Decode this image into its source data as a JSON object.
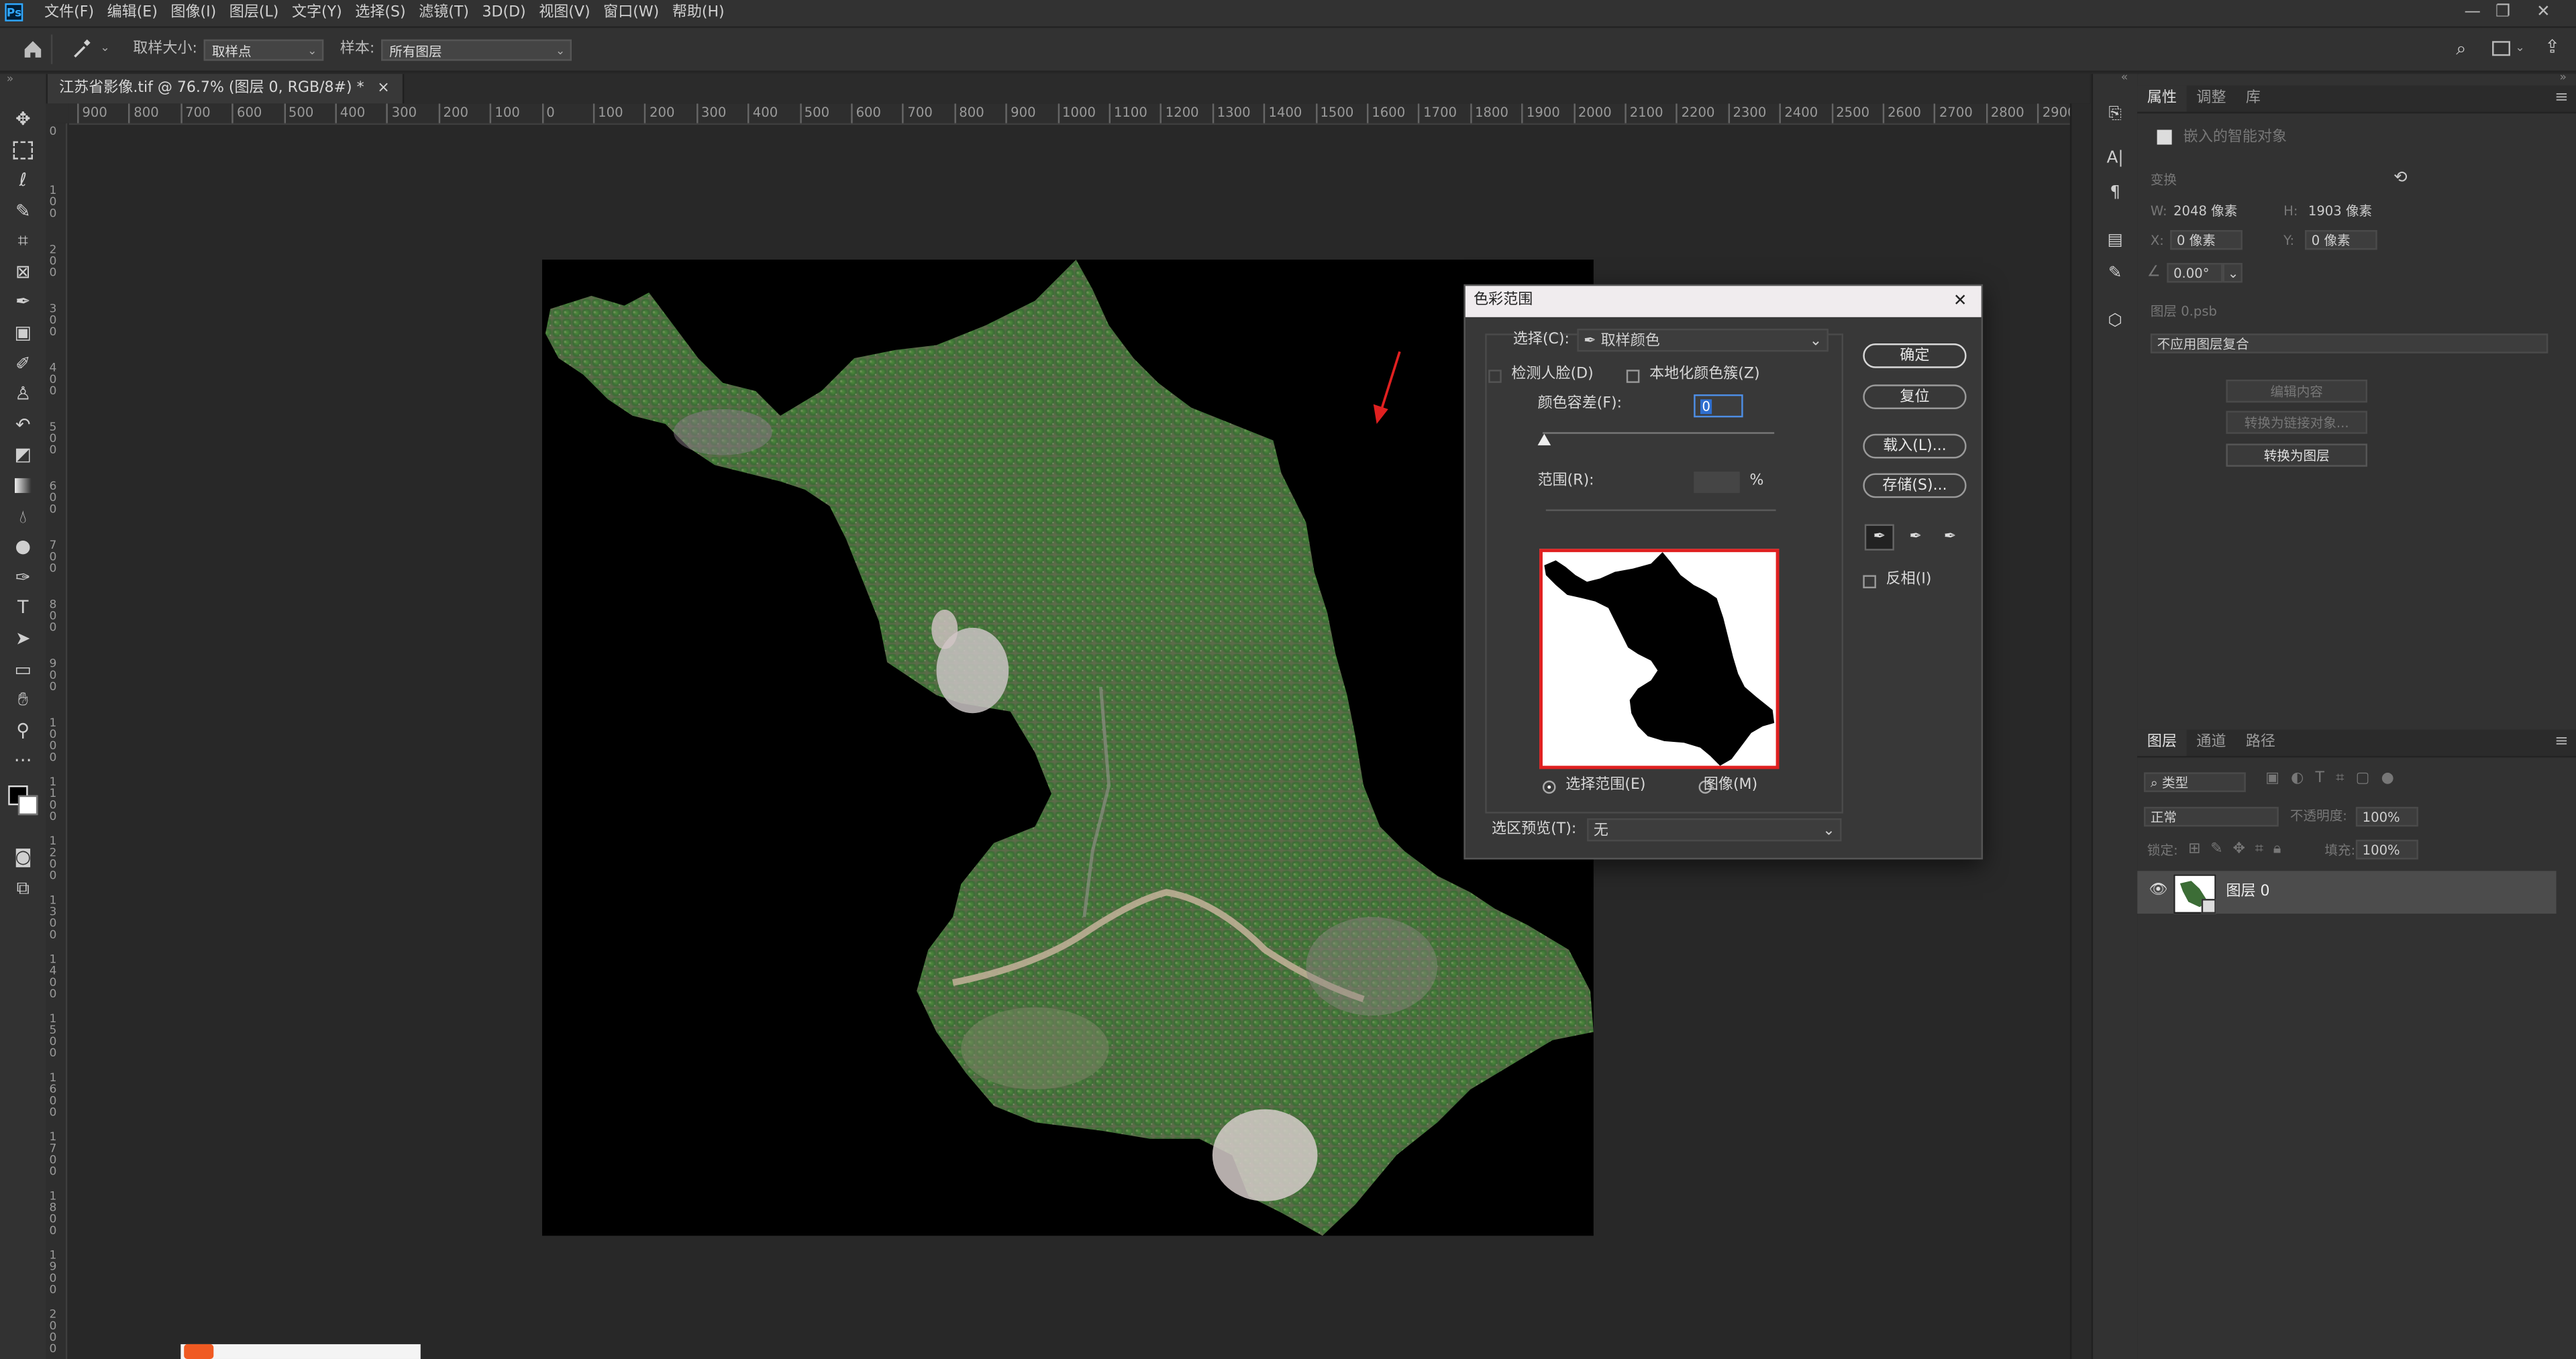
{
  "menubar": {
    "app_icon": "Ps",
    "items": [
      "文件(F)",
      "编辑(E)",
      "图像(I)",
      "图层(L)",
      "文字(Y)",
      "选择(S)",
      "滤镜(T)",
      "3D(D)",
      "视图(V)",
      "窗口(W)",
      "帮助(H)"
    ],
    "window_controls": [
      "—",
      "❐",
      "✕"
    ]
  },
  "options": {
    "sample_size_label": "取样大小:",
    "sample_size_value": "取样点",
    "sample_label": "样本:",
    "sample_value": "所有图层"
  },
  "document_tab": {
    "title": "江苏省影像.tif @ 76.7% (图层 0, RGB/8#) *",
    "close": "×"
  },
  "ruler": {
    "h_ticks": [
      "900",
      "800",
      "700",
      "600",
      "500",
      "400",
      "300",
      "200",
      "100",
      "0",
      "100",
      "200",
      "300",
      "400",
      "500",
      "600",
      "700",
      "800",
      "900",
      "1000",
      "1100",
      "1200",
      "1300",
      "1400",
      "1500",
      "1600",
      "1700",
      "1800",
      "1900",
      "2000",
      "2100",
      "2200",
      "2300",
      "2400",
      "2500",
      "2600",
      "2700",
      "2800",
      "2900"
    ],
    "v_ticks": [
      "0",
      "100",
      "200",
      "300",
      "400",
      "500",
      "600",
      "700",
      "800",
      "900",
      "1000",
      "1100",
      "1200",
      "1300",
      "1400",
      "1500",
      "1600",
      "1700",
      "1800",
      "1900",
      "2000"
    ]
  },
  "dialog": {
    "title": "色彩范围",
    "close": "✕",
    "select_label": "选择(C):",
    "select_value": "取样颜色",
    "detect_faces": "检测人脸(D)",
    "localized_clusters": "本地化颜色簇(Z)",
    "fuzziness_label": "颜色容差(F):",
    "fuzziness_value": "0",
    "range_label": "范围(R):",
    "range_unit": "%",
    "ok": "确定",
    "reset": "复位",
    "load": "载入(L)...",
    "save": "存储(S)...",
    "invert": "反相(I)",
    "view_selection": "选择范围(E)",
    "view_image": "图像(M)",
    "preview_label": "选区预览(T):",
    "preview_value": "无",
    "fuzziness_fraction": 0.0
  },
  "properties_panel": {
    "tabs": [
      "属性",
      "调整",
      "库"
    ],
    "object_type": "嵌入的智能对象",
    "transform_label": "变换",
    "w_label": "W:",
    "w_value": "2048 像素",
    "h_label": "H:",
    "h_value": "1903 像素",
    "x_label": "X:",
    "x_value": "0 像素",
    "y_label": "Y:",
    "y_value": "0 像素",
    "angle_value": "0.00°",
    "file_name": "图层 0.psb",
    "comp_value": "不应用图层复合",
    "btn_edit": "编辑内容",
    "btn_convert_linked": "转换为链接对象...",
    "btn_convert_layers": "转换为图层"
  },
  "layers_panel": {
    "tabs": [
      "图层",
      "通道",
      "路径"
    ],
    "filter_label": "类型",
    "blend_mode": "正常",
    "opacity_label": "不透明度:",
    "opacity_value": "100%",
    "lock_label": "锁定:",
    "fill_label": "填充:",
    "fill_value": "100%",
    "layers": [
      {
        "name": "图层 0",
        "visible": true
      }
    ]
  },
  "colors": {
    "accent_red": "#e02020",
    "map_green": "#3f7a3a"
  }
}
